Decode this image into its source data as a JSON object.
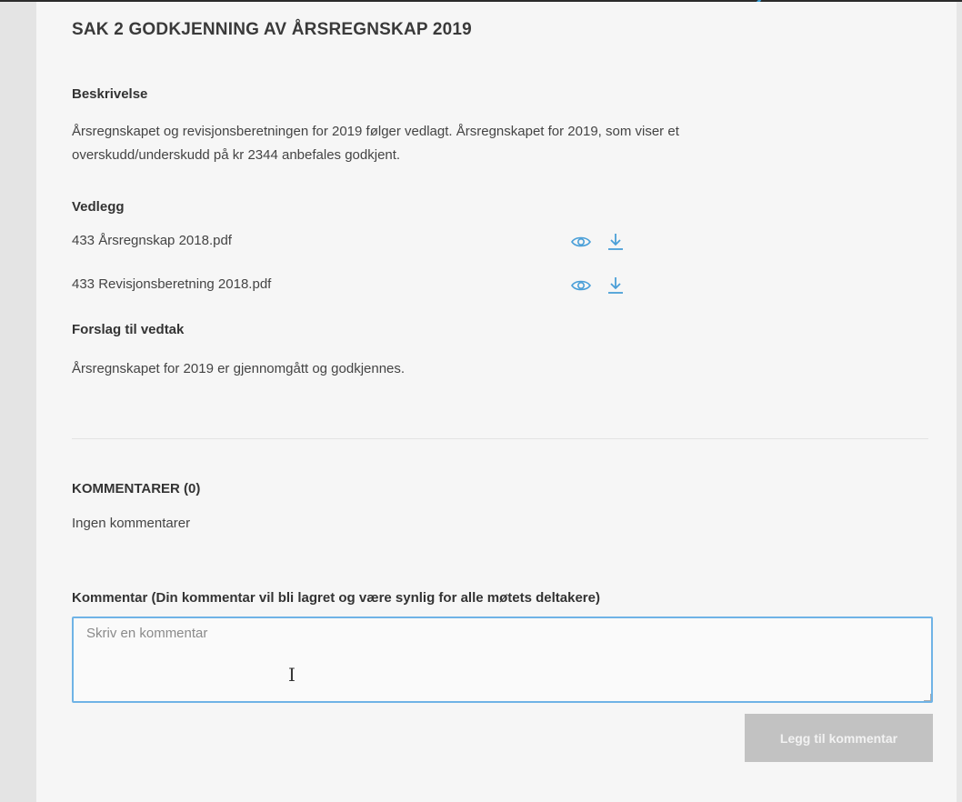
{
  "item": {
    "title": "SAK 2 GODKJENNING AV ÅRSREGNSKAP 2019",
    "description_label": "Beskrivelse",
    "description_line1": "Årsregnskapet og revisjonsberetningen for 2019 følger vedlagt. Årsregnskapet for 2019, som viser et",
    "description_line2": "overskudd/underskudd på kr 2344 anbefales godkjent.",
    "attachments_label": "Vedlegg",
    "attachments": [
      {
        "name": "433 Årsregnskap 2018.pdf",
        "view_icon": "eye-icon",
        "download_icon": "download-icon"
      },
      {
        "name": "433 Revisjonsberetning 2018.pdf",
        "view_icon": "eye-icon",
        "download_icon": "download-icon"
      }
    ],
    "proposal_label": "Forslag til vedtak",
    "proposal_text": "Årsregnskapet for 2019 er gjennomgått og godkjennes."
  },
  "comments": {
    "header": "KOMMENTARER (0)",
    "empty_text": "Ingen kommentarer",
    "field_label": "Kommentar (Din kommentar vil bli lagret og være synlig for alle møtets deltakere)",
    "placeholder": "Skriv en kommentar",
    "value": "",
    "submit_label": "Legg til kommentar"
  },
  "colors": {
    "accent": "#3aa0d8",
    "focus_border": "#6fb3e6",
    "button_disabled_bg": "#c2c2c2",
    "icon": "#4a9fd8"
  }
}
